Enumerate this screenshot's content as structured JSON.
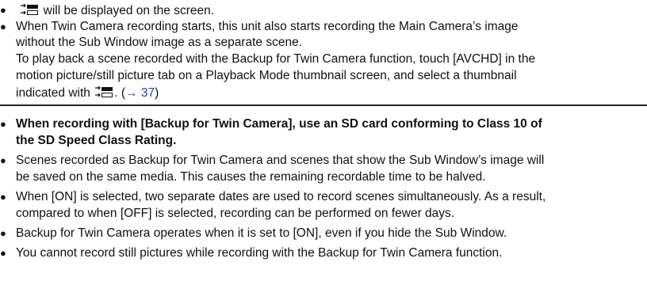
{
  "section1": {
    "bullet1_suffix": "will be displayed on the screen.",
    "bullet2_line1": "When Twin Camera recording starts, this unit also starts recording the Main Camera’s image",
    "bullet2_line2": "without the Sub Window image as a separate scene.",
    "para_line1": "To play back a scene recorded with the Backup for Twin Camera function, touch [AVCHD] in the",
    "para_line2": "motion picture/still picture tab on a Playback Mode thumbnail screen, and select a thumbnail",
    "para_line3_prefix": "indicated with",
    "para_ref_open": ". (",
    "para_ref_link": "→ 37",
    "para_ref_close": ")"
  },
  "section2": {
    "bold_line1": "When recording with [Backup for Twin Camera], use an SD card conforming to Class 10 of",
    "bold_line2": "the SD Speed Class Rating.",
    "b2_line1": "Scenes recorded as Backup for Twin Camera and scenes that show the Sub Window’s image will",
    "b2_line2": "be saved on the same media. This causes the remaining recordable time to be halved.",
    "b3_line1": "When [ON] is selected, two separate dates are used to record scenes simultaneously. As a result,",
    "b3_line2": "compared to when [OFF] is selected, recording can be performed on fewer days.",
    "b4_line1": "Backup for Twin Camera operates when it is set to [ON], even if you hide the Sub Window.",
    "b5_line1": "You cannot record still pictures while recording with the Backup for Twin Camera function."
  },
  "bullet_char": "●",
  "link_color": "#1a3fbf"
}
